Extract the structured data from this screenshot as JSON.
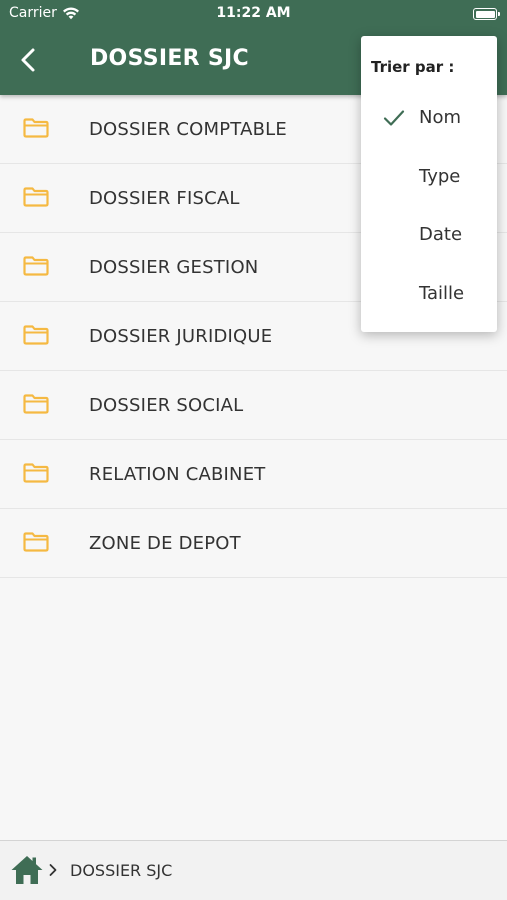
{
  "status_bar": {
    "carrier": "Carrier",
    "time": "11:22 AM",
    "battery_level_percent": 100
  },
  "nav": {
    "title": "DOSSIER SJC"
  },
  "folders": [
    {
      "label": "DOSSIER COMPTABLE",
      "icon": "folder-icon"
    },
    {
      "label": "DOSSIER FISCAL",
      "icon": "folder-icon"
    },
    {
      "label": "DOSSIER GESTION",
      "icon": "folder-icon"
    },
    {
      "label": "DOSSIER JURIDIQUE",
      "icon": "folder-icon"
    },
    {
      "label": "DOSSIER SOCIAL",
      "icon": "folder-icon"
    },
    {
      "label": "RELATION CABINET",
      "icon": "folder-icon"
    },
    {
      "label": "ZONE DE DEPOT",
      "icon": "folder-icon"
    }
  ],
  "sort_menu": {
    "title": "Trier par :",
    "options": [
      {
        "label": "Nom",
        "selected": true
      },
      {
        "label": "Type",
        "selected": false
      },
      {
        "label": "Date",
        "selected": false
      },
      {
        "label": "Taille",
        "selected": false
      }
    ]
  },
  "breadcrumb": {
    "items": [
      "DOSSIER SJC"
    ]
  },
  "colors": {
    "header_bg": "#3f6d55",
    "folder_icon": "#f5b942",
    "check_mark": "#3f6d55",
    "home_icon": "#3f6d55"
  }
}
